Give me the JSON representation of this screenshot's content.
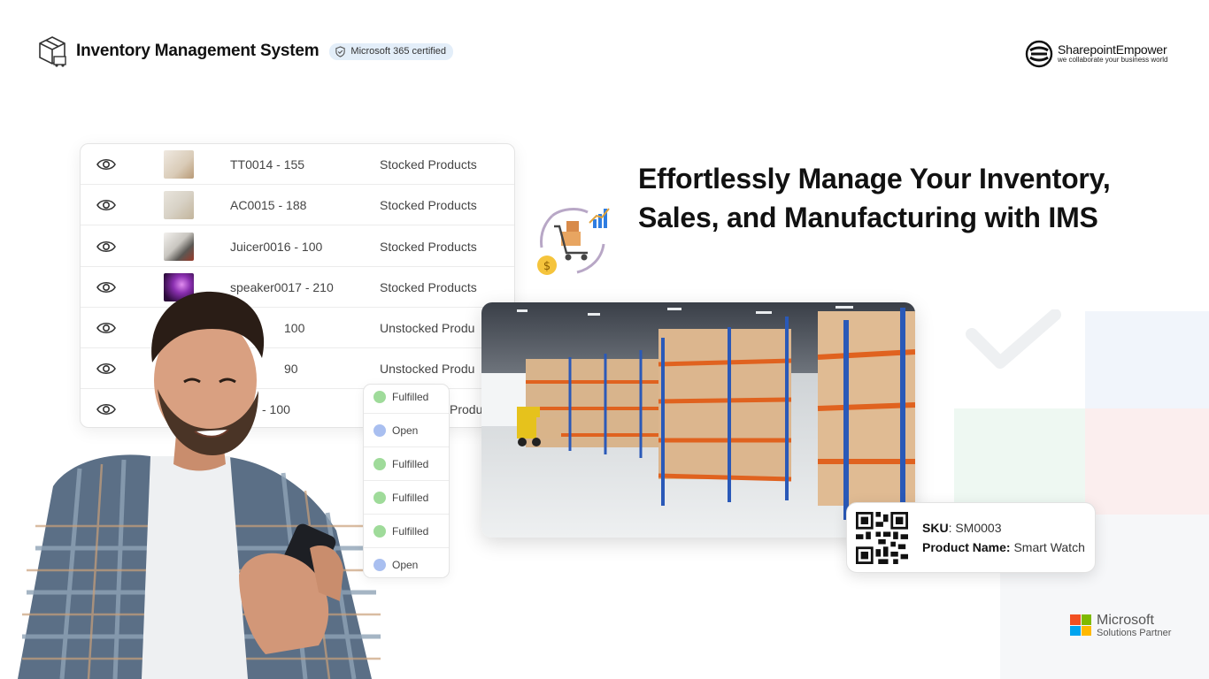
{
  "header": {
    "title": "Inventory Management  System",
    "certification_badge": "Microsoft 365 certified",
    "partner_brand": "SharepointEmpower",
    "partner_tagline": "we collaborate your business world"
  },
  "inventory_table": {
    "rows": [
      {
        "code": "TT0014 - 155",
        "status": "Stocked Products"
      },
      {
        "code": "AC0015 - 188",
        "status": "Stocked Products"
      },
      {
        "code": "Juicer0016 - 100",
        "status": "Stocked Products"
      },
      {
        "code": "speaker0017 - 210",
        "status": "Stocked Products"
      },
      {
        "code": "100",
        "status": "Unstocked Produ"
      },
      {
        "code": "90",
        "status": "Unstocked Produ"
      },
      {
        "code": "- 100",
        "status": "Produ"
      }
    ]
  },
  "fulfillment_status": {
    "items": [
      "Fulfilled",
      "Open",
      "Fulfilled",
      "Fulfilled",
      "Fulfilled",
      "Open"
    ]
  },
  "headline": {
    "line1": "Effortlessly Manage Your Inventory,",
    "line2": "Sales, and Manufacturing with IMS"
  },
  "sku_card": {
    "sku_label": "SKU",
    "sku_value": ": SM0003",
    "name_label": "Product Name:",
    "name_value": "Smart Watch"
  },
  "footer_partner": {
    "name": "Microsoft",
    "subtitle": "Solutions Partner"
  },
  "colors": {
    "fulfilled": "#9fdb9a",
    "open": "#a9bff0",
    "badge_bg": "#e3eef9",
    "shelf_orange": "#e0621f",
    "shelf_blue": "#2a59b8",
    "ms_red": "#f25022",
    "ms_green": "#7fba00",
    "ms_blue": "#00a4ef",
    "ms_yellow": "#ffb900"
  },
  "icons": [
    "inventory-box-icon",
    "shield-check-icon",
    "sharepointempower-logo-icon",
    "eye-icon",
    "cart-boxes-icon",
    "qr-code-icon",
    "microsoft-logo-icon"
  ]
}
